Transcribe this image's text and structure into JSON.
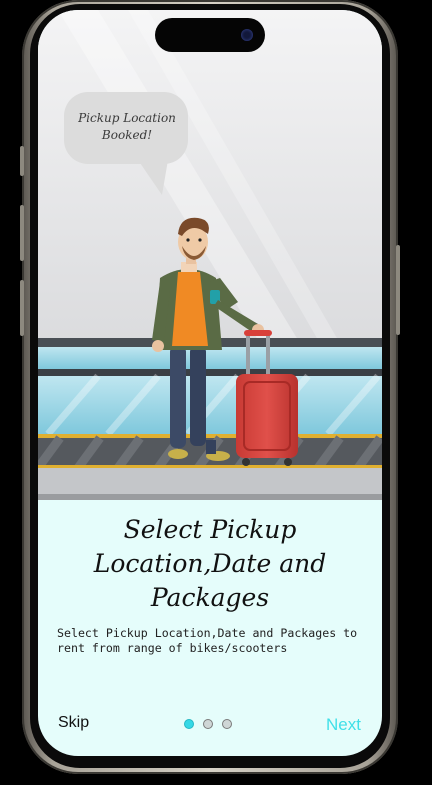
{
  "onboarding": {
    "speech_bubble": "Pickup Location\nBooked!",
    "title": "Select Pickup\nLocation,Date and\nPackages",
    "description": "Select Pickup Location,Date and  Packages to\n  rent from range of bikes/scooters",
    "page_indicator": {
      "current": 1,
      "total": 3
    }
  },
  "footer": {
    "skip_label": "Skip",
    "next_label": "Next"
  },
  "colors": {
    "accent": "#40e0e8",
    "background": "#e5fdfb",
    "luggage": "#d8403a"
  }
}
